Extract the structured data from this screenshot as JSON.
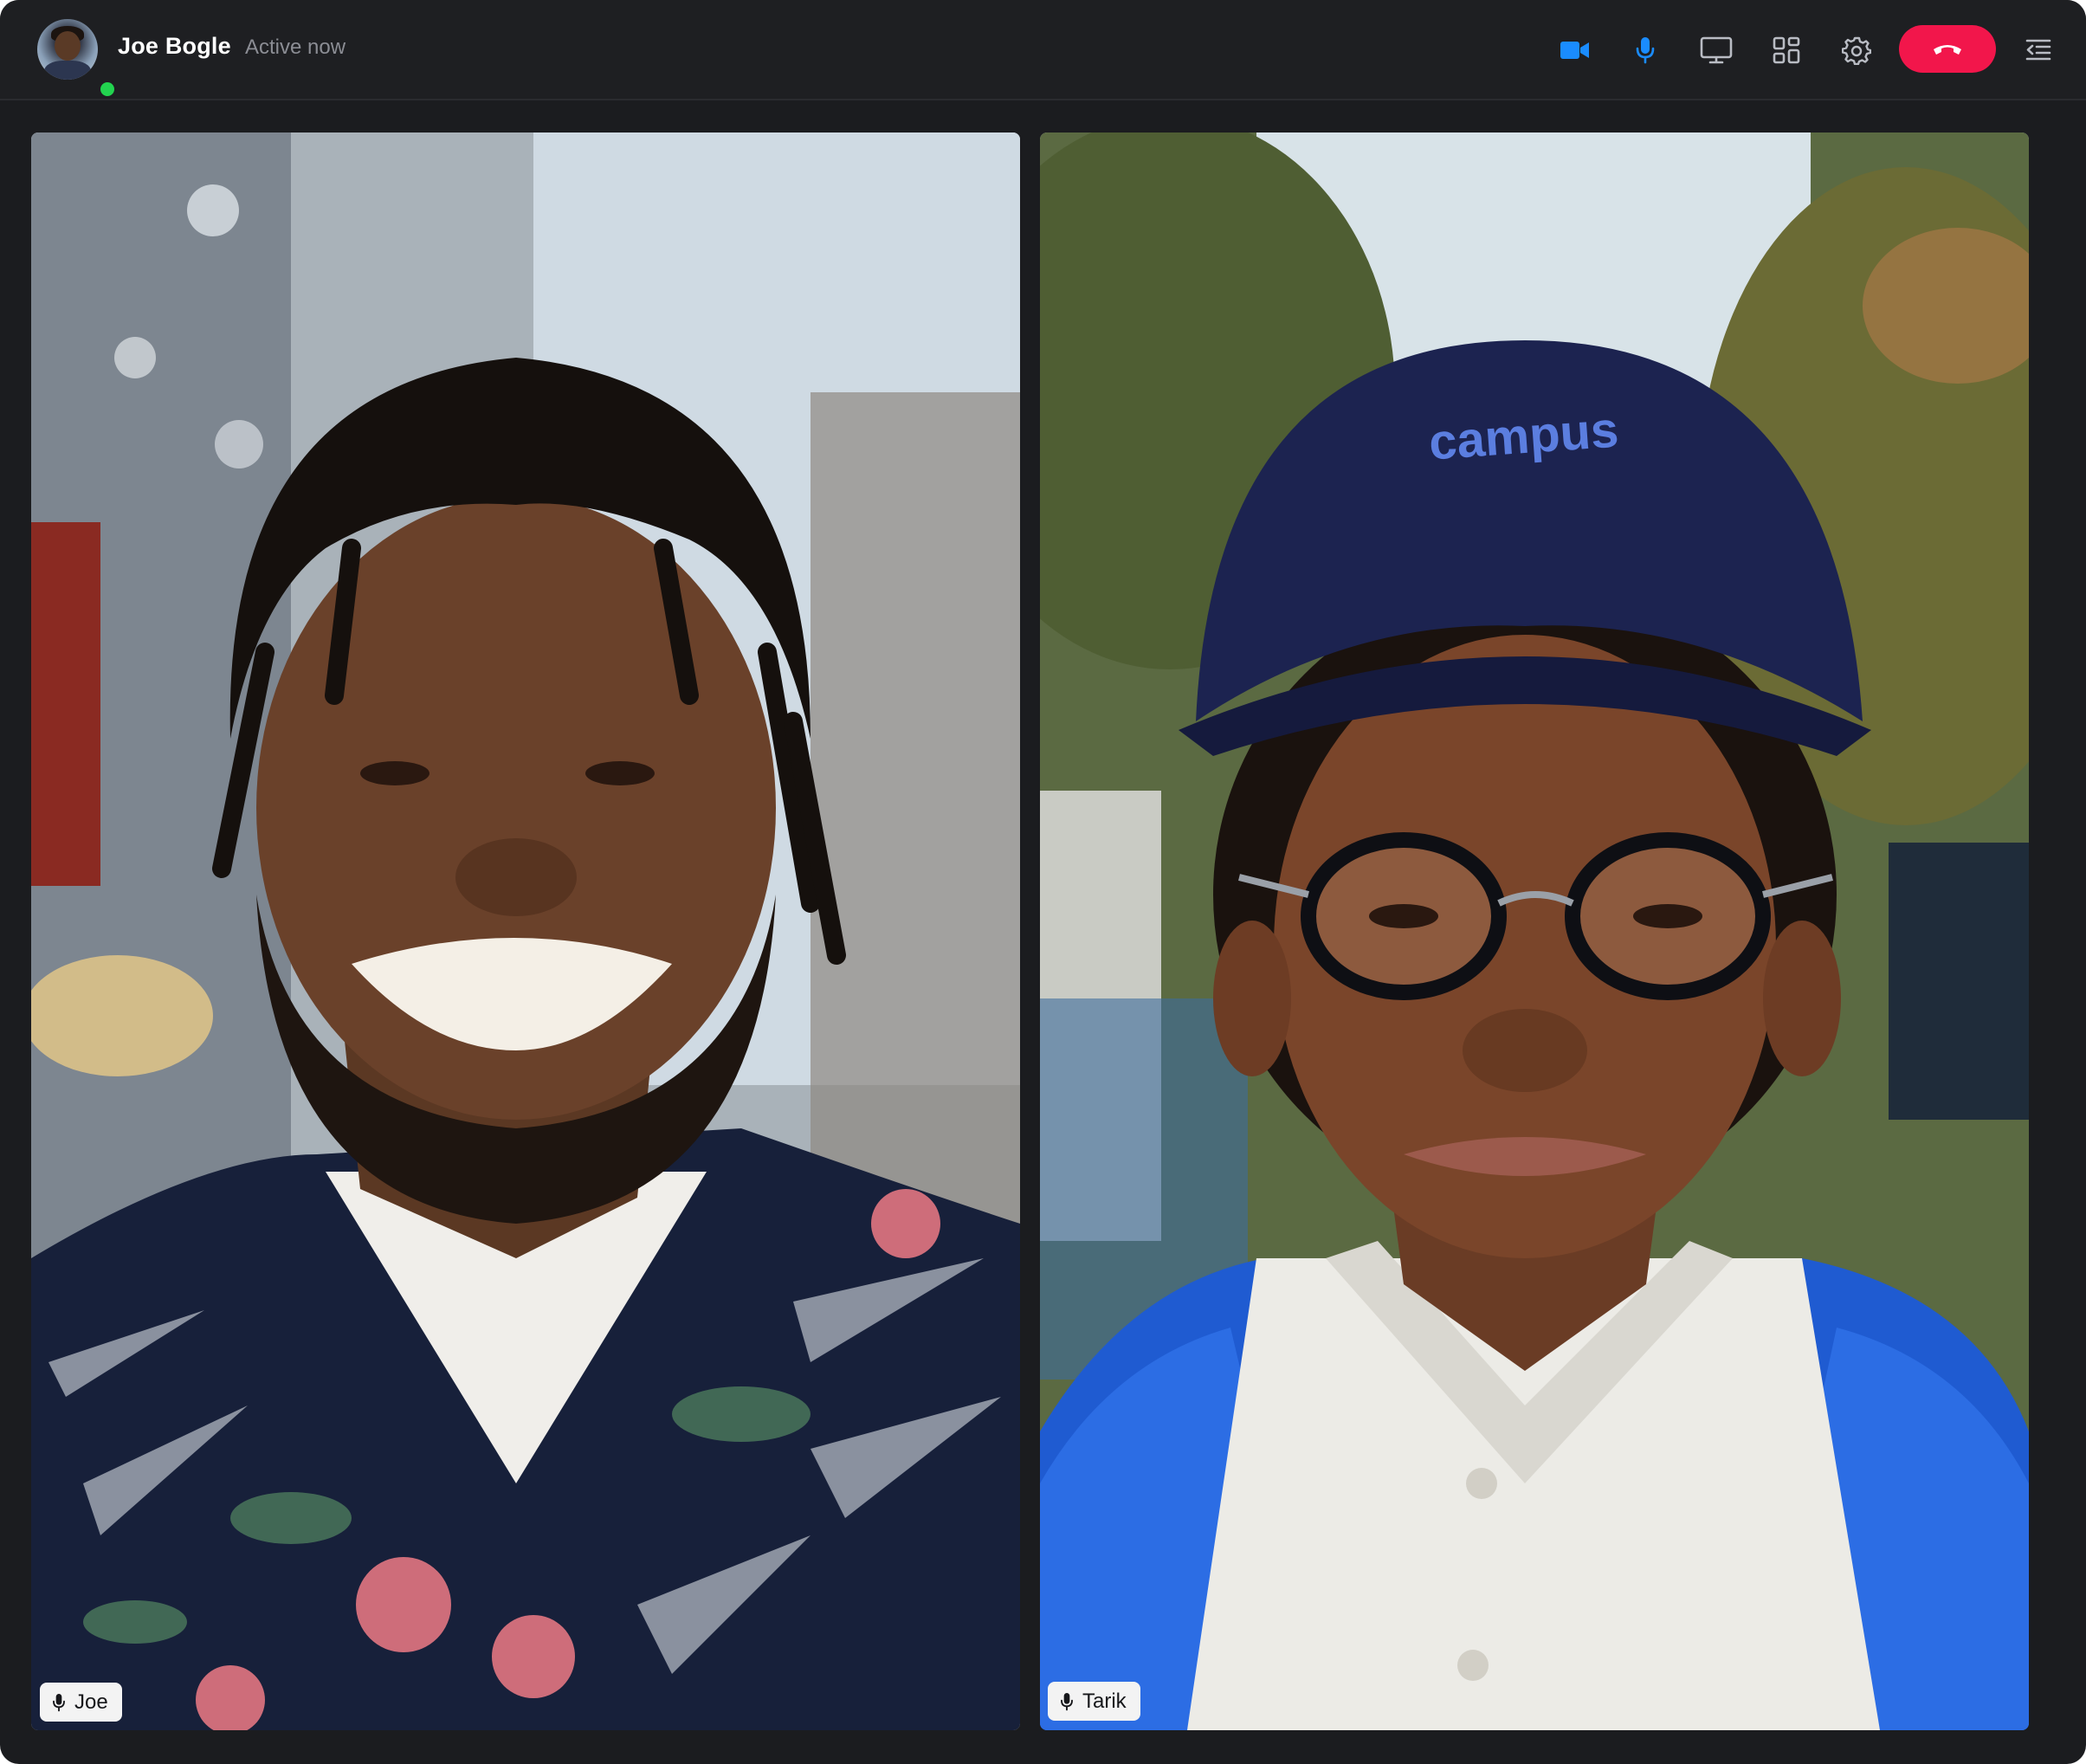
{
  "header": {
    "user_name": "Joe Bogle",
    "status_text": "Active now",
    "status_color": "#22d34f",
    "controls": [
      {
        "name": "video-camera-icon",
        "active": true
      },
      {
        "name": "microphone-icon",
        "active": true
      },
      {
        "name": "screen-share-icon",
        "active": false
      },
      {
        "name": "grid-layout-icon",
        "active": false
      },
      {
        "name": "settings-gear-icon",
        "active": false
      },
      {
        "name": "end-call-phone-icon",
        "color": "#f2164b"
      },
      {
        "name": "sidebar-menu-icon",
        "active": false
      }
    ],
    "accent_color": "#1a8cff"
  },
  "participants": [
    {
      "label": "Joe",
      "icon": "microphone-icon"
    },
    {
      "label": "Tarik",
      "icon": "microphone-icon"
    }
  ]
}
